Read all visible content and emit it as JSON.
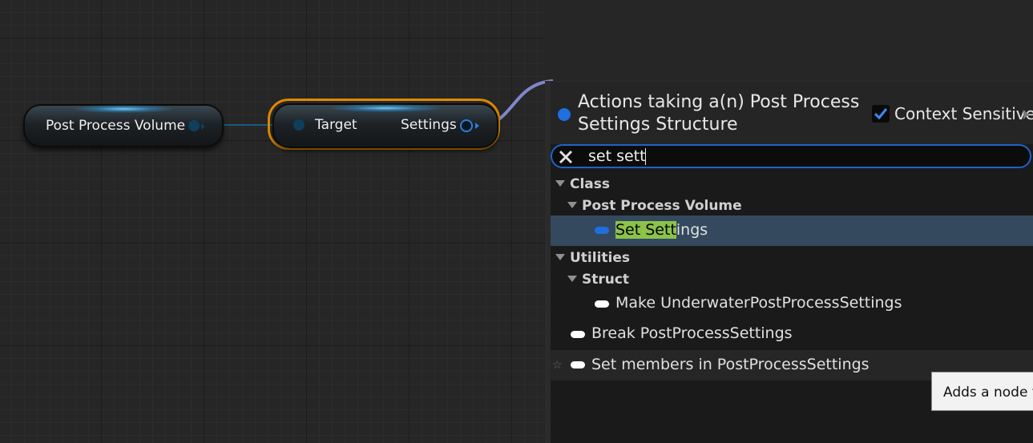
{
  "graph": {
    "node_ppv": {
      "label": "Post Process Volume"
    },
    "node_getter": {
      "target_label": "Target",
      "settings_label": "Settings"
    }
  },
  "menu": {
    "title": "Actions taking a(n) Post Process Settings Structure",
    "context_sensitive": {
      "label": "Context Sensitive",
      "checked": true
    },
    "search": {
      "value": "set sett"
    },
    "tree": {
      "class": "Class",
      "post_process_volume": "Post Process Volume",
      "set_settings": {
        "highlight": "Set Sett",
        "rest": "ings"
      },
      "utilities": "Utilities",
      "struct": "Struct",
      "make_underwater": "Make UnderwaterPostProcessSettings",
      "break_pps": "Break PostProcessSettings",
      "set_members": "Set members in PostProcessSettings"
    }
  },
  "tooltip": {
    "text": "Adds a node th"
  },
  "colors": {
    "accent": "#1c65c7",
    "selection_outline": "#e08a00",
    "match_highlight": "#8bc34a",
    "selected_row": "#34495e",
    "struct_pin": "#1f6fe0"
  },
  "icons": {
    "clear": "close-icon",
    "expand": "triangle-down-icon",
    "favorite": "star-icon",
    "check": "checkmark-icon"
  }
}
